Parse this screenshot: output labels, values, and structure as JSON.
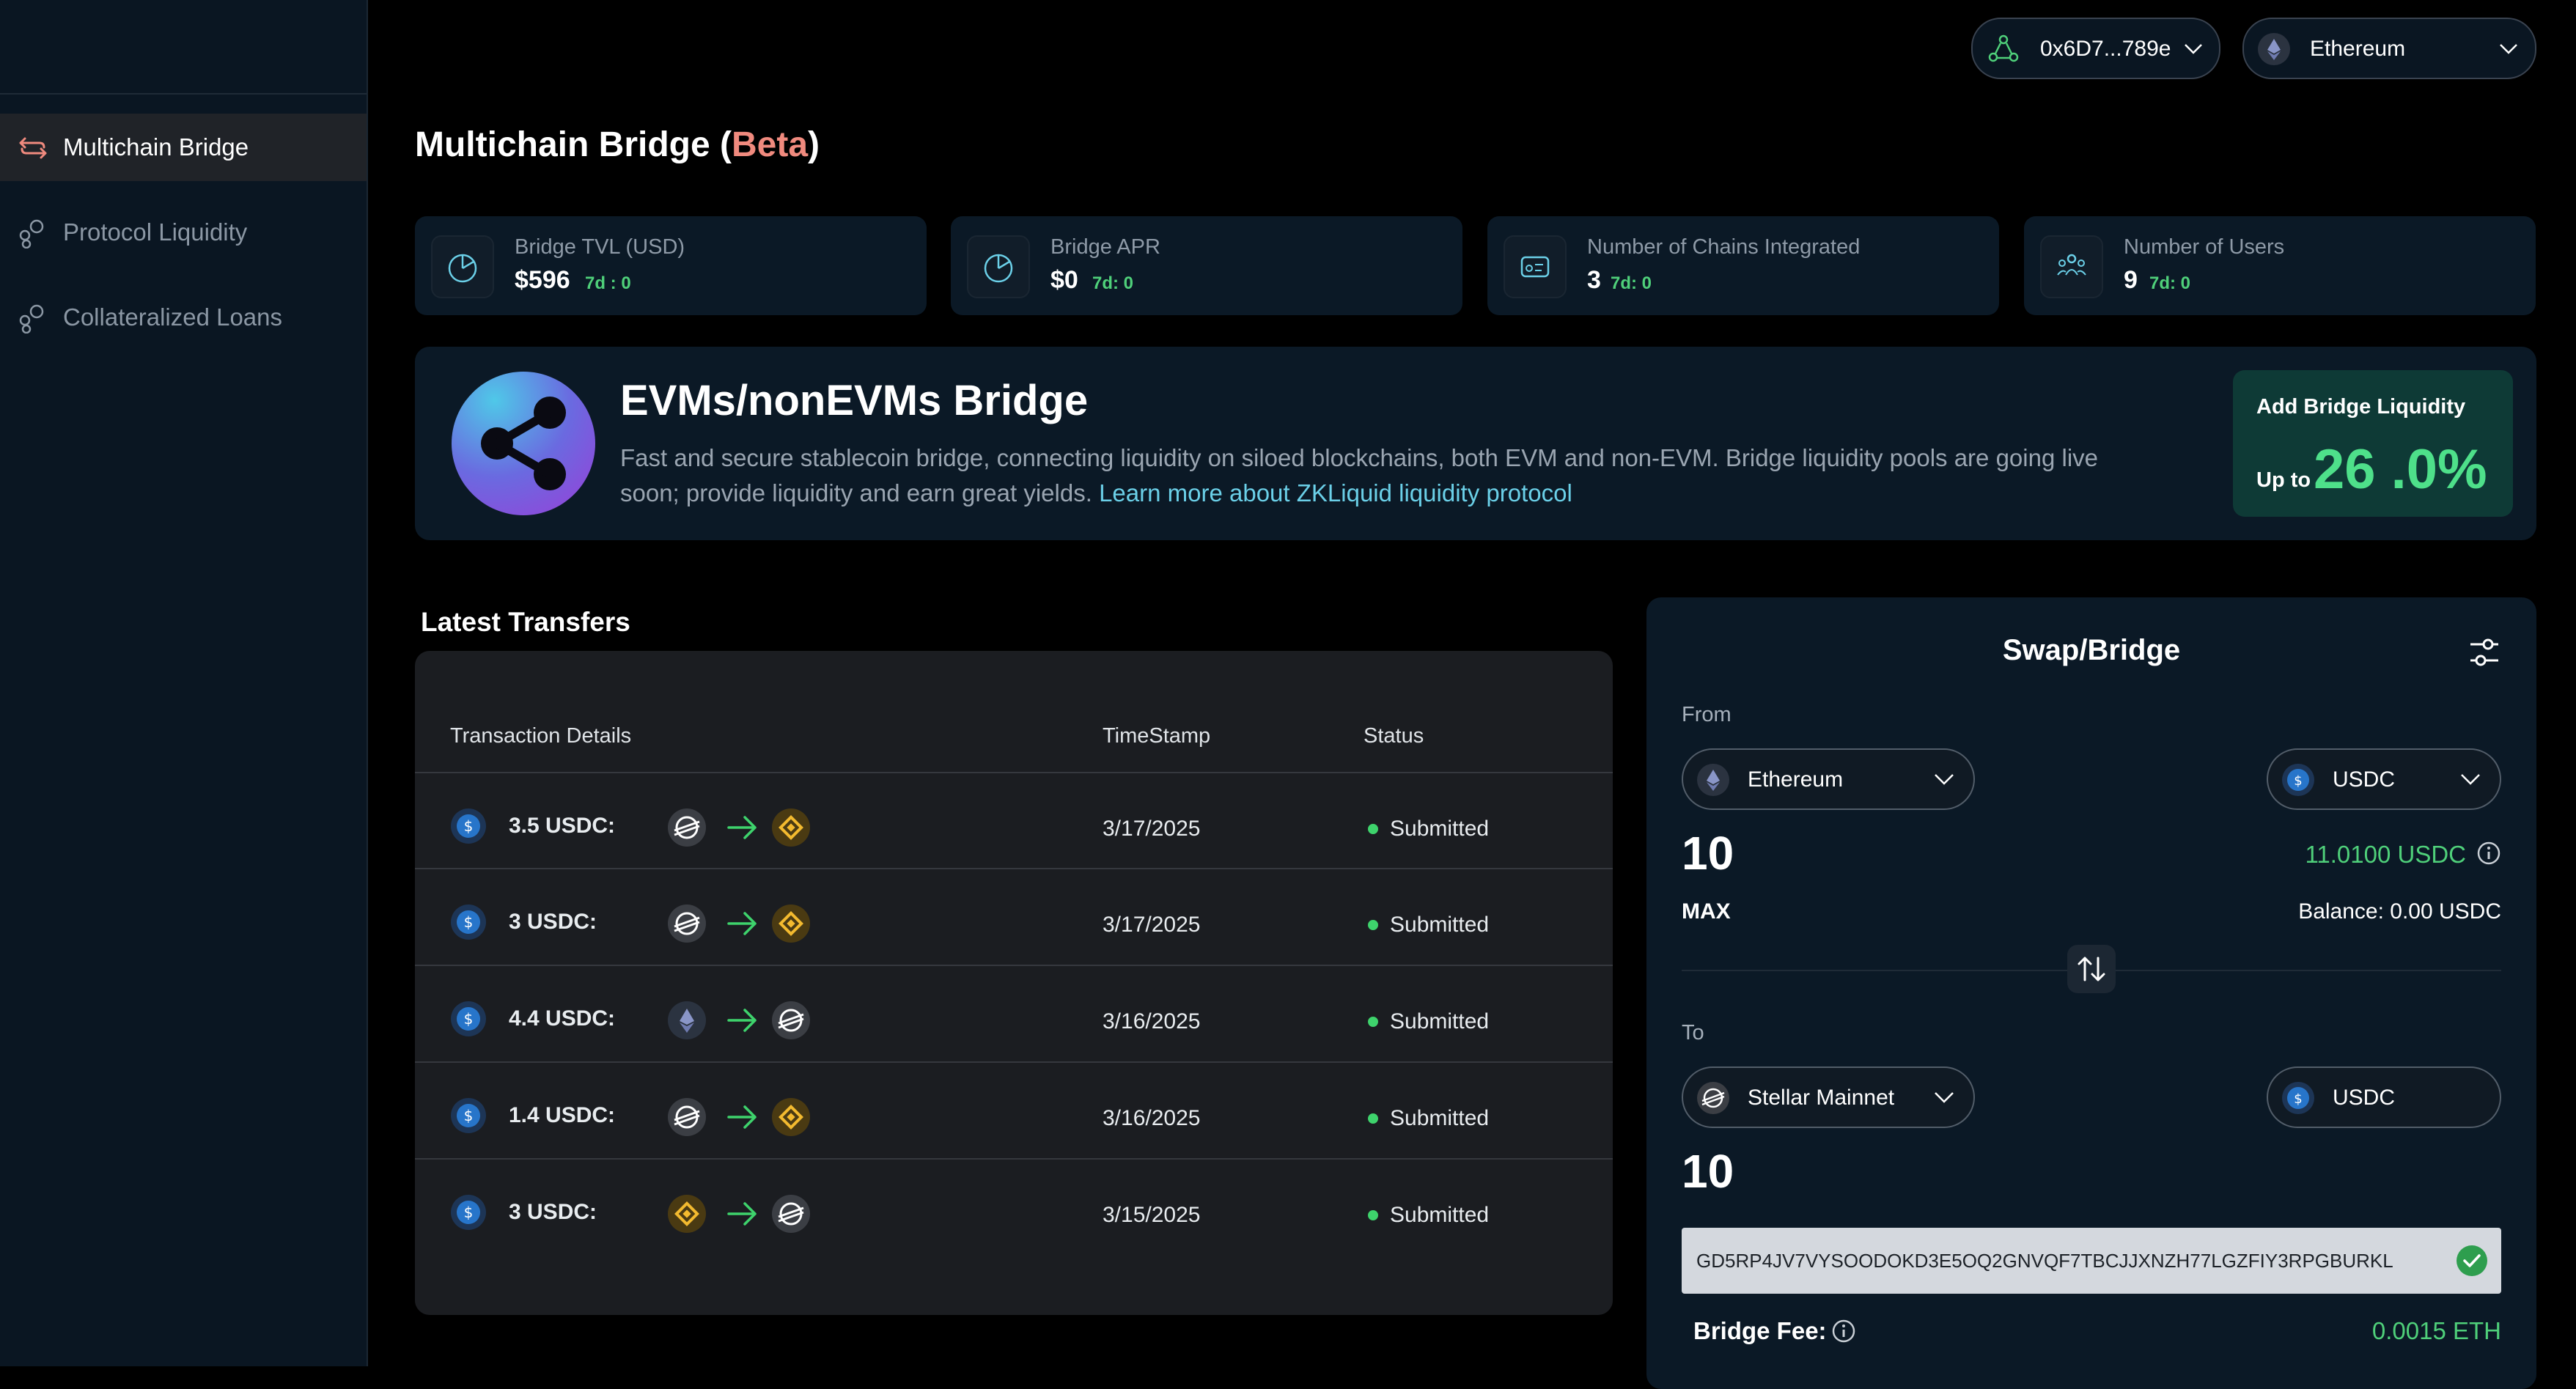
{
  "sidebar": {
    "items": [
      {
        "label": "Multichain Bridge",
        "active": true,
        "icon": "bridge-icon"
      },
      {
        "label": "Protocol Liquidity",
        "active": false,
        "icon": "nodes-icon"
      },
      {
        "label": "Collateralized Loans",
        "active": false,
        "icon": "nodes-icon"
      }
    ]
  },
  "header": {
    "wallet": "0x6D7...789e",
    "network": "Ethereum"
  },
  "page": {
    "title_pre": "Multichain Bridge (",
    "title_beta": "Beta",
    "title_post": ")"
  },
  "stats": [
    {
      "label": "Bridge TVL (USD)",
      "value": "$596",
      "change": "7d : 0",
      "icon": "pie-chart-icon"
    },
    {
      "label": "Bridge APR",
      "value": "$0",
      "change": "7d: 0",
      "icon": "pie-chart-icon"
    },
    {
      "label": "Number of Chains Integrated",
      "value": "3",
      "change": "7d: 0",
      "icon": "chains-icon"
    },
    {
      "label": "Number of Users",
      "value": "9",
      "change": "7d: 0",
      "icon": "users-icon"
    }
  ],
  "banner": {
    "title": "EVMs/nonEVMs Bridge",
    "description": "Fast and secure stablecoin bridge, connecting liquidity on siloed blockchains, both EVM and non-EVM. Bridge liquidity pools are going live soon; provide liquidity and earn great yields.",
    "link": "Learn more about ZKLiquid liquidity protocol",
    "liquidity_title": "Add Bridge Liquidity",
    "liquidity_prefix": "Up to",
    "liquidity_value": "26 .0%"
  },
  "transfers": {
    "title": "Latest Transfers",
    "columns": [
      "Transaction Details",
      "TimeStamp",
      "Status"
    ],
    "rows": [
      {
        "amount": "3.5 USDC:",
        "from": "stellar",
        "to": "bnb",
        "timestamp": "3/17/2025",
        "status": "Submitted"
      },
      {
        "amount": "3 USDC:",
        "from": "stellar",
        "to": "bnb",
        "timestamp": "3/17/2025",
        "status": "Submitted"
      },
      {
        "amount": "4.4 USDC:",
        "from": "ethereum",
        "to": "stellar",
        "timestamp": "3/16/2025",
        "status": "Submitted"
      },
      {
        "amount": "1.4 USDC:",
        "from": "stellar",
        "to": "bnb",
        "timestamp": "3/16/2025",
        "status": "Submitted"
      },
      {
        "amount": "3 USDC:",
        "from": "bnb",
        "to": "stellar",
        "timestamp": "3/15/2025",
        "status": "Submitted"
      }
    ]
  },
  "swap": {
    "title": "Swap/Bridge",
    "from_label": "From",
    "from_chain": "Ethereum",
    "from_token": "USDC",
    "from_amount": "10",
    "available": "11.0100 USDC",
    "max_label": "MAX",
    "balance": "Balance: 0.00 USDC",
    "to_label": "To",
    "to_chain": "Stellar Mainnet",
    "to_token": "USDC",
    "to_amount": "10",
    "address": "GD5RP4JV7VYSOODOKD3E5OQ2GNVQF7TBCJJXNZH77LGZFIY3RPGBURKL",
    "fee_label": "Bridge Fee:",
    "fee_value": "0.0015 ETH"
  },
  "colors": {
    "accent_green": "#4fd07a",
    "beta": "#f08a7e",
    "link": "#6bd0e8",
    "usdc": "#2775ca",
    "bnb": "#f3ba2f"
  }
}
